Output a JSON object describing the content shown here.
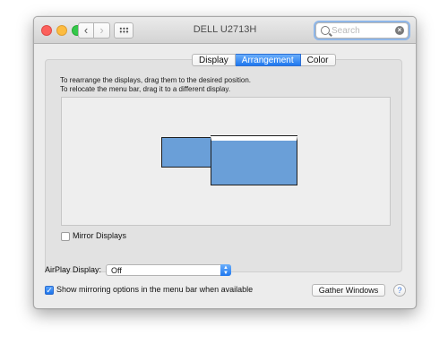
{
  "window": {
    "title": "DELL U2713H"
  },
  "titlebar": {
    "nav_back": "‹",
    "nav_forward": "›",
    "search_placeholder": "Search",
    "clear_glyph": "×"
  },
  "tabs": [
    {
      "label": "Display",
      "active": false
    },
    {
      "label": "Arrangement",
      "active": true
    },
    {
      "label": "Color",
      "active": false
    }
  ],
  "arrangement": {
    "instruction_line1": "To rearrange the displays, drag them to the desired position.",
    "instruction_line2": "To relocate the menu bar, drag it to a different display.",
    "display_color": "#6a9fd8"
  },
  "mirror_displays": {
    "label": "Mirror Displays",
    "checked": false
  },
  "airplay": {
    "label": "AirPlay Display:",
    "value": "Off"
  },
  "show_mirroring": {
    "label": "Show mirroring options in the menu bar when available",
    "checked": true,
    "check_glyph": "✓"
  },
  "buttons": {
    "gather": "Gather Windows",
    "help": "?"
  },
  "colors": {
    "accent": "#1f78ef",
    "window_bg": "#ececec"
  }
}
